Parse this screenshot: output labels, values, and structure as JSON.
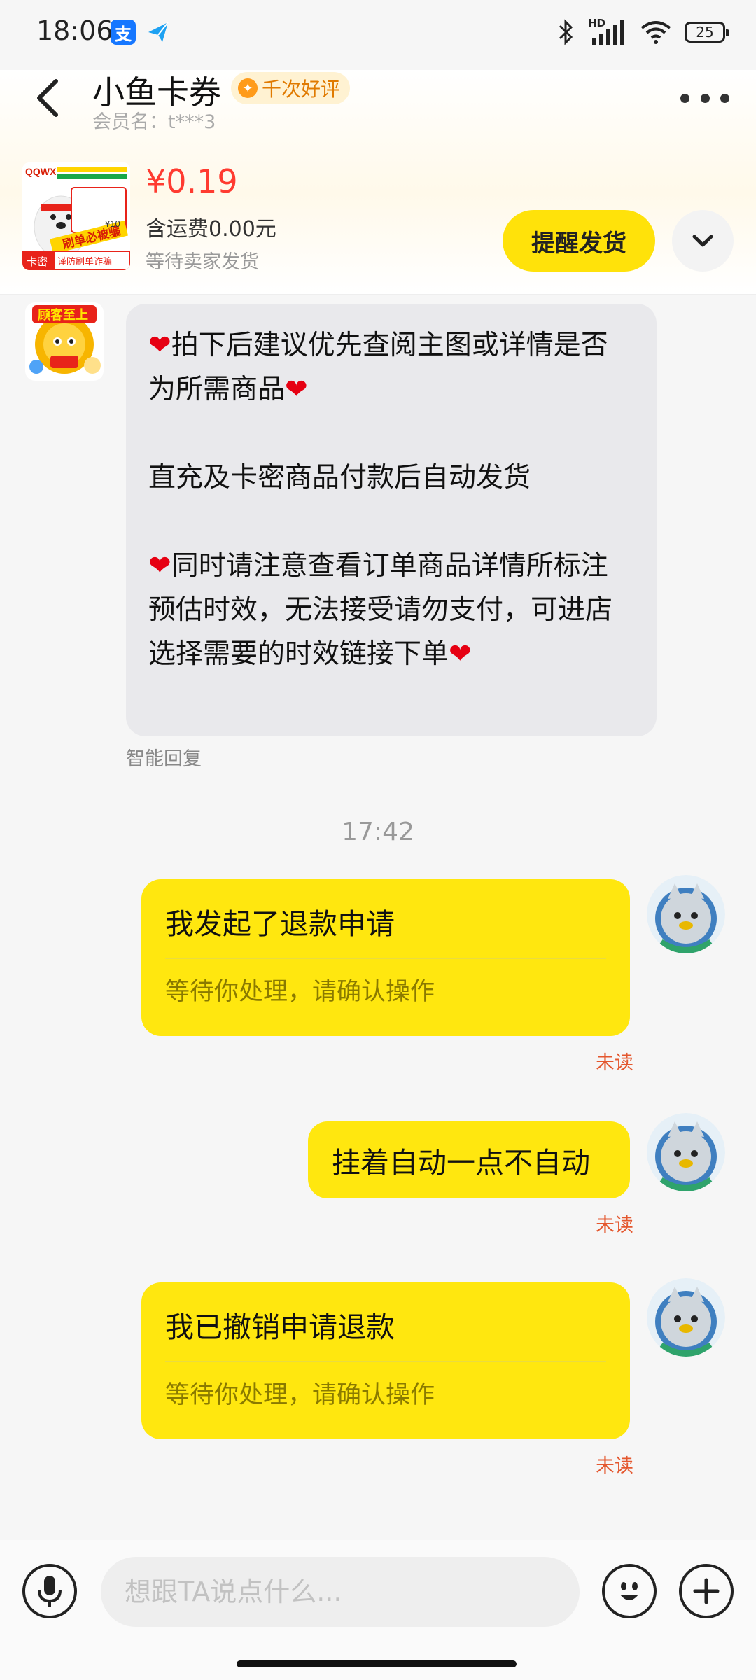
{
  "status_bar": {
    "time": "18:06",
    "alipay_glyph": "支",
    "hd_label": "HD",
    "battery_level": "25"
  },
  "header": {
    "seller_name": "小鱼卡券",
    "rating_badge": "千次好评",
    "member_label": "会员名：t***3"
  },
  "order": {
    "price": "¥0.19",
    "shipping": "含运费0.00元",
    "status": "等待卖家发货",
    "remind_button": "提醒发货",
    "thumb_texts": {
      "top_banner": "QQWX",
      "center_ribbon": "刷单必被骗",
      "price_tag": "¥10",
      "corner_label": "卡密",
      "bottom_label": "谨防刷单诈骗"
    }
  },
  "seller_avatar": {
    "banner": "顾客至上"
  },
  "messages": {
    "auto_reply": {
      "line1": "拍下后建议优先查阅主图或详情是否为所需商品",
      "line2": "直充及卡密商品付款后自动发货",
      "line3": "同时请注意查看订单商品详情所标注预估时效，无法接受请勿支付，可进店选择需要的时效链接下单",
      "tag": "智能回复"
    },
    "timestamp": "17:42",
    "refund_card": {
      "title": "我发起了退款申请",
      "subtitle": "等待你处理，请确认操作",
      "status": "未读"
    },
    "text_message": {
      "text": "挂着自动一点不自动",
      "status": "未读"
    },
    "cancel_card": {
      "title": "我已撤销申请退款",
      "subtitle": "等待你处理，请确认操作",
      "status": "未读"
    }
  },
  "input": {
    "placeholder": "想跟TA说点什么..."
  },
  "colors": {
    "accent_yellow": "#ffe70f",
    "price_red": "#ff3b30",
    "unread_red": "#e4572e"
  }
}
